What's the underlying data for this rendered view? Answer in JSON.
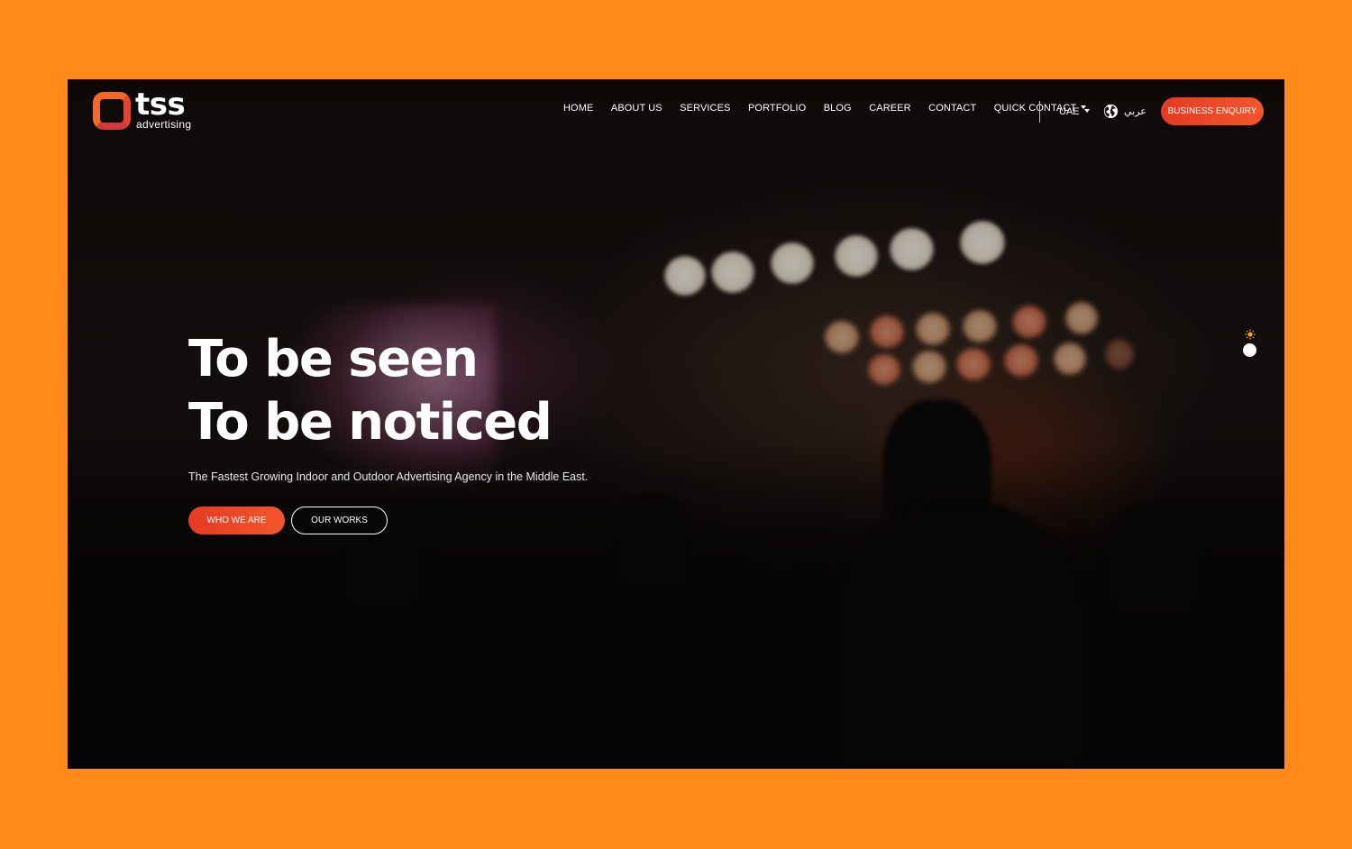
{
  "brand": {
    "name": "tss",
    "tagline": "advertising"
  },
  "nav": {
    "items": [
      {
        "label": "HOME"
      },
      {
        "label": "ABOUT US"
      },
      {
        "label": "SERVICES"
      },
      {
        "label": "PORTFOLIO"
      },
      {
        "label": "BLOG"
      },
      {
        "label": "CAREER"
      },
      {
        "label": "CONTACT"
      },
      {
        "label": "QUICK CONTACT"
      }
    ],
    "region": "UAE",
    "language": "عربي",
    "cta": "BUSINESS ENQUIRY"
  },
  "hero": {
    "line1": "To be seen",
    "line2": "To be noticed",
    "subtitle": "The Fastest Growing Indoor and Outdoor Advertising Agency in the Middle East.",
    "primary_button": "WHO WE ARE",
    "secondary_button": "OUR WORKS"
  },
  "colors": {
    "page_background": "#ff8a1a",
    "accent": "#f04a26",
    "text": "#ffffff"
  },
  "icons": {
    "globe": "globe-icon",
    "theme": "sun-icon",
    "dropdown": "chevron-down-icon"
  }
}
